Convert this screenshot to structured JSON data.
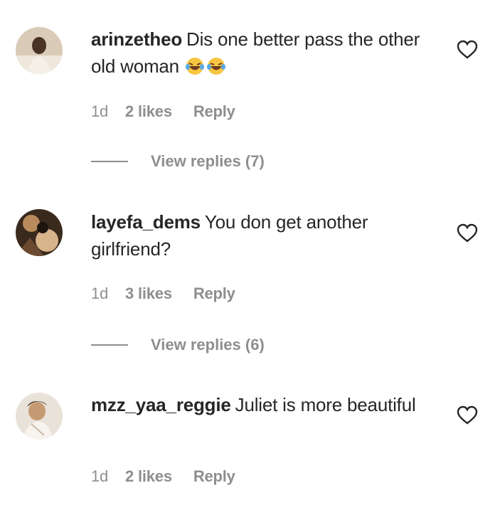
{
  "comments": [
    {
      "username": "arinzetheo",
      "text": "Dis one better pass the other old woman",
      "emoji": "face-with-tears-of-joy x2",
      "time": "1d",
      "likes": "2 likes",
      "reply": "Reply",
      "view_replies": "View replies (7)"
    },
    {
      "username": "layefa_dems",
      "text": "You don get another girlfriend?",
      "time": "1d",
      "likes": "3 likes",
      "reply": "Reply",
      "view_replies": "View replies (6)"
    },
    {
      "username": "mzz_yaa_reggie",
      "text": "Juliet is more beautiful",
      "time": "1d",
      "likes": "2 likes",
      "reply": "Reply"
    }
  ],
  "icons": {
    "like": "heart-icon"
  },
  "colors": {
    "text": "#262626",
    "muted": "#8e8e8e",
    "background": "#ffffff"
  }
}
